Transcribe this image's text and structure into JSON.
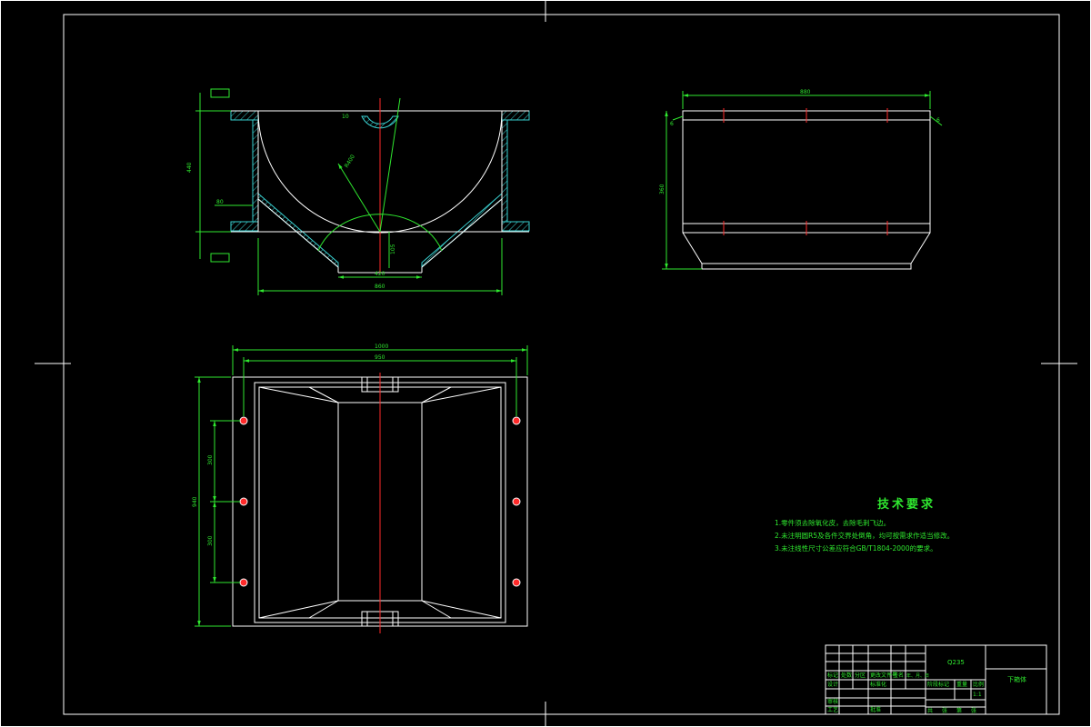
{
  "drawing": {
    "front_view": {
      "dims": {
        "overall_width": "860",
        "bottom_width": "420",
        "total_height": "440",
        "flange_height": "80",
        "inner_depth": "105",
        "arc_radius": "R400",
        "upper_thk": "10"
      }
    },
    "side_view": {
      "dims": {
        "width": "880",
        "height": "360",
        "left_weld": "6",
        "right_weld": "6"
      }
    },
    "plan_view": {
      "dims": {
        "overall_width": "1000",
        "inner_width": "950",
        "height": "940",
        "spacing_1": "300",
        "spacing_2": "300"
      }
    },
    "tech_notes": {
      "title": "技术要求",
      "lines": [
        "1.零件须去除氧化皮，去除毛刺飞边。",
        "2.未注明圆R5及各件交界处倒角，均可按需求作适当修改。",
        "3.未注线性尺寸公差应符合GB/T1804-2000的要求。"
      ]
    },
    "title_block": {
      "material": "Q235",
      "part_name": "下箱体",
      "scale": "1:1",
      "labels": [
        "标记",
        "处数",
        "分区",
        "更改文件号",
        "签名",
        "年、月、日",
        "设计",
        "标准化",
        "审核",
        "工艺",
        "批准",
        "阶段标记",
        "重量",
        "比例",
        "共",
        "张",
        "第",
        "张"
      ]
    }
  },
  "colors": {
    "background": "#000000",
    "outline": "#ffffff",
    "dimension": "#2fe82f",
    "centerline": "#ff2a2a",
    "hatch": "#39d0d0"
  }
}
